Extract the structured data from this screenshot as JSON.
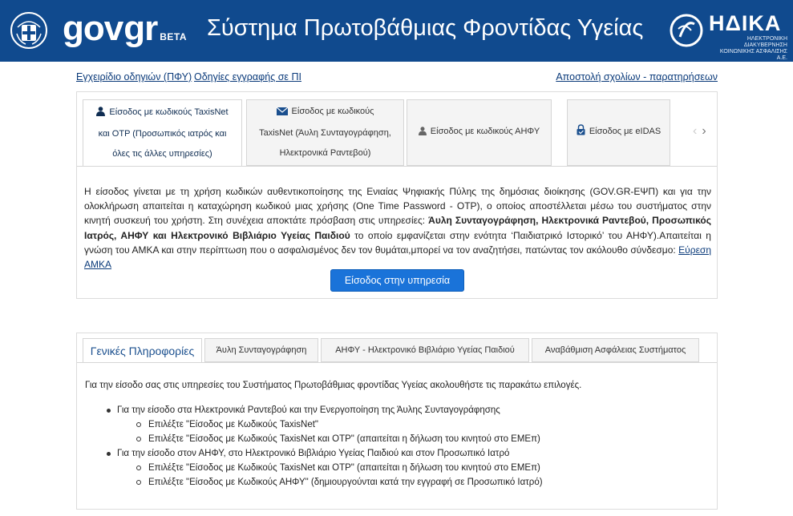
{
  "header": {
    "gov_text": "gov",
    "gr_text": "gr",
    "beta_text": "BETA",
    "site_title": "Σύστημα Πρωτοβάθμιας Φροντίδας Υγείας",
    "idika_name": "ΗΔΙΚΑ",
    "idika_sub_line1": "ΗΛΕΚΤΡΟΝΙΚΗ ΔΙΑΚΥΒΕΡΝΗΣΗ",
    "idika_sub_line2": "ΚΟΙΝΩΝΙΚΗΣ ΑΣΦΑΛΙΣΗΣ Α.Ε.",
    "bar_color": "#104a8e"
  },
  "links": {
    "manual": "Εγχειρίδιο οδηγιών (ΠΦΥ)",
    "registration": "Οδηγίες εγγραφής σε ΠΙ",
    "feedback": "Αποστολή σχολίων - παρατηρήσεων"
  },
  "login_tabs": [
    {
      "line1": "Είσοδος με κωδικούς TaxisNet",
      "line2": "και OTP (Προσωπικός ιατρός και",
      "line3": "όλες τις άλλες υπηρεσίες)",
      "icon": "user-icon"
    },
    {
      "line1": "Είσοδος με κωδικούς",
      "line2": "TaxisNet (Άυλη Συνταγογράφηση,",
      "line3": "Ηλεκτρονικά Ραντεβού)",
      "icon": "envelope-icon"
    },
    {
      "line1": "Είσοδος με κωδικούς ΑΗΦΥ",
      "icon": "user-icon"
    },
    {
      "line1": "Είσοδος με eIDAS",
      "icon": "lock-icon"
    }
  ],
  "login_panel": {
    "desc_p1": "Η είσοδος γίνεται με τη χρήση κωδικών αυθεντικοποίησης της Ενιαίας Ψηφιακής Πύλης της δημόσιας διοίκησης (GOV.GR-ΕΨΠ) και για την ολοκλήρωση απαιτείται η καταχώρηση κωδικού μιας χρήσης (One Time Password - OTP), ο οποίος αποστέλλεται μέσω του συστήματος στην κινητή συσκευή του χρήστη. Στη συνέχεια αποκτάτε πρόσβαση στις υπηρεσίες: ",
    "desc_bold": "Άυλη Συνταγογράφηση, Ηλεκτρονικά Ραντεβού, Προσωπικός Ιατρός, ΑΗΦΥ και Ηλεκτρονικό Βιβλιάριο Υγείας Παιδιού",
    "desc_p2": " το οποίο εμφανίζεται στην ενότητα ‘Παιδιατρικό Ιστορικό’ του ΑΗΦΥ).Απαιτείται η γνώση του ΑΜΚΑ και στην περίπτωση που ο ασφαλισμένος δεν τον θυμάται,μπορεί να τον αναζητήσει, πατώντας τον ακόλουθο σύνδεσμο: ",
    "desc_link": "Εύρεση ΑΜΚΑ",
    "button_label": "Είσοδος στην υπηρεσία",
    "button_color": "#1a73d9"
  },
  "info_tabs": [
    "Γενικές Πληροφορίες",
    "Άυλη Συνταγογράφηση",
    "ΑΗΦΥ - Ηλεκτρονικό Βιβλιάριο Υγείας Παιδιού",
    "Αναβάθμιση Ασφάλειας Συστήματος"
  ],
  "info": {
    "intro": "Για την είσοδο σας στις υπηρεσίες του Συστήματος Πρωτοβάθμιας φροντίδας Υγείας ακολουθήστε τις παρακάτω επιλογές.",
    "item1": "Για την είσοδο στα Ηλεκτρονικά Ραντεβού και την Ενεργοποίηση της Άυλης Συνταγογράφησης",
    "item1_sub1": "Επιλέξτε \"Είσοδος με Κωδικούς TaxisNet\"",
    "item1_sub2": "Επιλέξτε \"Είσοδος με Κωδικούς TaxisNet και OTP\" (απαιτείται η δήλωση του κινητού στο ΕΜΕπ)",
    "item2": "Για την είσοδο στον ΑΗΦΥ, στο Ηλεκτρονικό Βιβλιάριο Υγείας Παιδιού και στον Προσωπικό Ιατρό",
    "item2_sub1": "Επιλέξτε \"Είσοδος με Κωδικούς TaxisNet και OTP\" (απαιτείται η δήλωση του κινητού στο ΕΜΕπ)",
    "item2_sub2": "Επιλέξτε \"Είσοδος με Κωδικούς ΑΗΦΥ\" (δημιουργούνται κατά την εγγραφή σε Προσωπικό Ιατρό)"
  }
}
